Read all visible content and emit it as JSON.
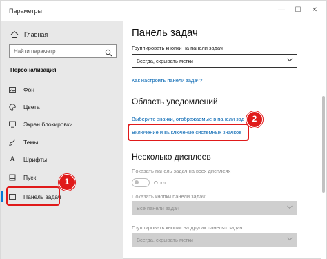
{
  "window": {
    "title": "Параметры",
    "controls": {
      "minimize": "—",
      "maximize": "☐",
      "close": "✕"
    }
  },
  "sidebar": {
    "home": "Главная",
    "search_placeholder": "Найти параметр",
    "section": "Персонализация",
    "items": [
      {
        "label": "Фон",
        "icon": "picture-icon"
      },
      {
        "label": "Цвета",
        "icon": "palette-icon"
      },
      {
        "label": "Экран блокировки",
        "icon": "lock-screen-icon"
      },
      {
        "label": "Темы",
        "icon": "brush-icon"
      },
      {
        "label": "Шрифты",
        "icon": "font-icon"
      },
      {
        "label": "Пуск",
        "icon": "start-icon"
      },
      {
        "label": "Панель задач",
        "icon": "taskbar-icon",
        "active": true
      }
    ]
  },
  "content": {
    "title": "Панель задач",
    "group_buttons_label": "Группировать кнопки на панели задач",
    "group_buttons_value": "Всегда, скрывать метки",
    "howto_link": "Как настроить панели задач?",
    "notif_heading": "Область уведомлений",
    "notif_link1": "Выберите значки, отображаемые в панели задач",
    "notif_link2": "Включение и выключение системных значков",
    "multi_heading": "Несколько дисплеев",
    "show_all_displays_label": "Показать панель задач на всех дисплеях",
    "toggle_state": "Откл.",
    "show_buttons_label": "Показать кнопки панели задач:",
    "show_buttons_value": "Все панели задач",
    "group_other_label": "Группировать кнопки на других панелях задач",
    "group_other_value": "Всегда, скрывать метки"
  },
  "annotations": {
    "badge1": "1",
    "badge2": "2"
  },
  "colors": {
    "accent": "#0078d7",
    "link": "#0063b1",
    "highlight": "#e01a1a",
    "sidebar_bg": "#e8e8e8"
  }
}
